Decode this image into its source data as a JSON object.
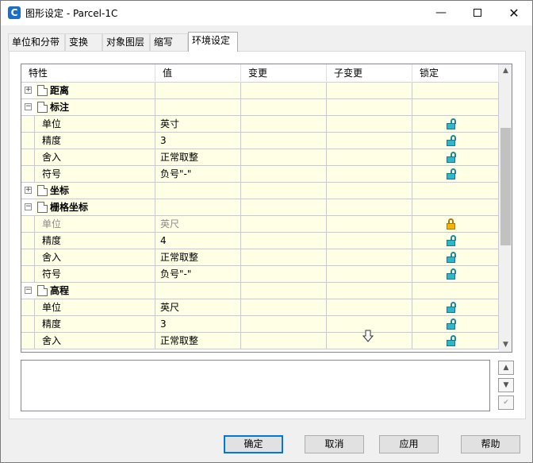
{
  "window": {
    "title": "图形设定 - Parcel-1C",
    "app_icon_letter": "C",
    "controls": {
      "minimize": "—",
      "close": "✕"
    }
  },
  "tabs": [
    {
      "label": "单位和分带",
      "active": false
    },
    {
      "label": "变换",
      "active": false
    },
    {
      "label": "对象图层",
      "active": false
    },
    {
      "label": "缩写",
      "active": false
    },
    {
      "label": "环境设定",
      "active": true
    }
  ],
  "grid": {
    "columns": [
      "特性",
      "值",
      "变更",
      "子变更",
      "锁定"
    ],
    "groups": [
      {
        "label": "距离",
        "expander": "+",
        "rows": []
      },
      {
        "label": "标注",
        "expander": "−",
        "rows": [
          {
            "property": "单位",
            "value": "英寸",
            "lock": "unlocked"
          },
          {
            "property": "精度",
            "value": "3",
            "lock": "unlocked"
          },
          {
            "property": "舍入",
            "value": "正常取整",
            "lock": "unlocked"
          },
          {
            "property": "符号",
            "value": "负号\"-\"",
            "lock": "unlocked"
          }
        ]
      },
      {
        "label": "坐标",
        "expander": "+",
        "rows": []
      },
      {
        "label": "栅格坐标",
        "expander": "−",
        "rows": [
          {
            "property": "单位",
            "value": "英尺",
            "lock": "locked",
            "disabled": true
          },
          {
            "property": "精度",
            "value": "4",
            "lock": "unlocked"
          },
          {
            "property": "舍入",
            "value": "正常取整",
            "lock": "unlocked"
          },
          {
            "property": "符号",
            "value": "负号\"-\"",
            "lock": "unlocked"
          }
        ]
      },
      {
        "label": "高程",
        "expander": "−",
        "rows": [
          {
            "property": "单位",
            "value": "英尺",
            "lock": "unlocked"
          },
          {
            "property": "精度",
            "value": "3",
            "lock": "unlocked"
          },
          {
            "property": "舍入",
            "value": "正常取整",
            "lock": "unlocked"
          }
        ]
      }
    ],
    "scroll": {
      "up": "▲",
      "down": "▼"
    }
  },
  "buttons": {
    "ok": "确定",
    "cancel": "取消",
    "apply": "应用",
    "help": "帮助"
  },
  "colors": {
    "cell_bg": "#ffffe6",
    "unlock_icon": "#2fb7c9",
    "lock_icon": "#f5b400",
    "default_button_border": "#0078d7"
  }
}
